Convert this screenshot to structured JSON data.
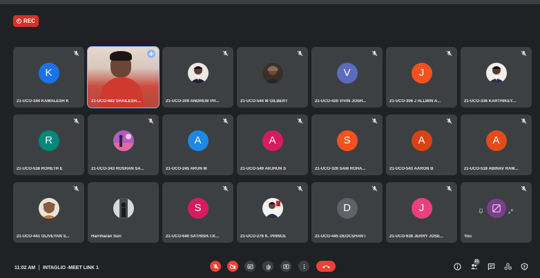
{
  "recording": {
    "label": "REC"
  },
  "participants": [
    {
      "name": "21-UCO-344 KAMALESH K",
      "initial": "K",
      "color": "#1a73e8"
    },
    {
      "name": "21-UCO-662 SHAILESH....",
      "active": true
    },
    {
      "name": "21-UCO-309 ANDREW PR..."
    },
    {
      "name": "21-UCO-544 M GILBERT"
    },
    {
      "name": "21-UCO-420 VIVIN JOSH...",
      "initial": "V",
      "color": "#5c6bc0"
    },
    {
      "name": "21-UCO-306 J ALLWIN A...",
      "initial": "J",
      "color": "#f4511e"
    },
    {
      "name": "21-UCO-336 KARTHIKEY..."
    },
    {
      "name": "21-UCO-538 ROHETH E",
      "initial": "R",
      "color": "#00897b"
    },
    {
      "name": "21-UCO-343 ROSHAN SA..."
    },
    {
      "name": "21-UCO-245 ARUN M",
      "initial": "A",
      "color": "#1e88e5"
    },
    {
      "name": "21-UCO-549 ARJHUN S",
      "initial": "A",
      "color": "#d81b60"
    },
    {
      "name": "21-UCO-326 SAM ROHA...",
      "initial": "S",
      "color": "#f4511e"
    },
    {
      "name": "21-UCO-543 AARON B",
      "initial": "A",
      "color": "#d84315"
    },
    {
      "name": "21-UCO-518 ABINAV RAM...",
      "initial": "A",
      "color": "#e64a19"
    },
    {
      "name": "21-UCO-441 OLIVEYAN S..."
    },
    {
      "name": "Harriharan Suri"
    },
    {
      "name": "21-UCO-640 SATHISH.T.K...",
      "initial": "S",
      "color": "#d81b60"
    },
    {
      "name": "21-UCO-276 K. PRINCE"
    },
    {
      "name": "21-UCO-445 DEOCSHAN I",
      "initial": "D",
      "color": "#5f6368"
    },
    {
      "name": "21-UCO-638 JERRY JOSE...",
      "initial": "J",
      "color": "#ec407a"
    },
    {
      "name": "You"
    }
  ],
  "footer": {
    "time": "11:02 AM",
    "meeting_title": "INTAGLIO -MEET LINK 1",
    "people_count": "21"
  },
  "colors": {
    "accent": "#8ab4f8",
    "danger": "#ea4335",
    "tile": "#3c4043",
    "background": "#202124"
  }
}
